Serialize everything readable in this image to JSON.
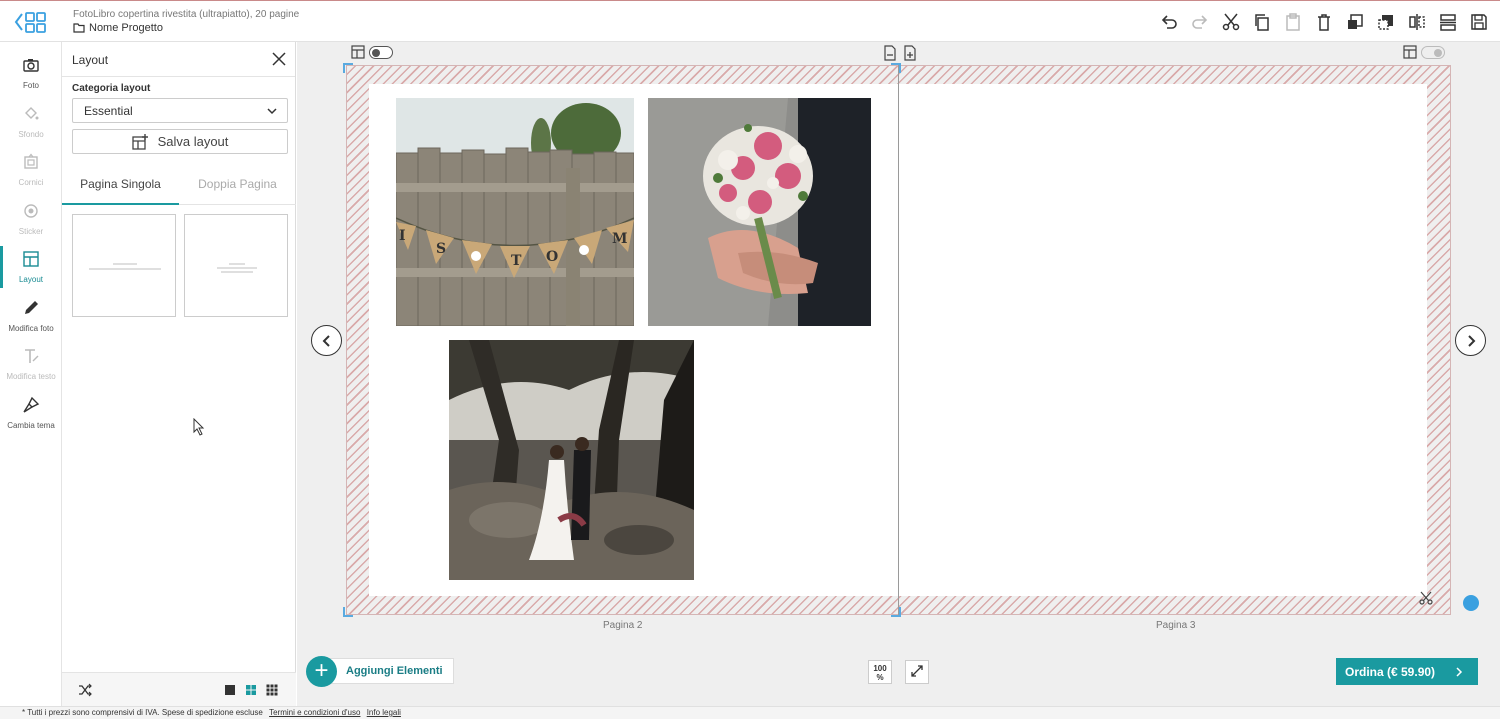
{
  "header": {
    "product": "FotoLibro copertina rivestita (ultrapiatto), 20 pagine",
    "project_name": "Nome Progetto",
    "toolbar": [
      "undo-icon",
      "redo-icon",
      "cut-icon",
      "copy-icon",
      "paste-icon",
      "delete-icon",
      "bring-forward-icon",
      "send-backward-icon",
      "mirror-icon",
      "align-icon",
      "save-icon"
    ]
  },
  "rail": {
    "items": [
      {
        "label": "Foto",
        "icon": "camera-icon",
        "disabled": false
      },
      {
        "label": "Sfondo",
        "icon": "paint-bucket-icon",
        "disabled": true
      },
      {
        "label": "Cornici",
        "icon": "frame-icon",
        "disabled": true
      },
      {
        "label": "Sticker",
        "icon": "sticker-icon",
        "disabled": true
      },
      {
        "label": "Layout",
        "icon": "layout-icon",
        "disabled": false,
        "active": true
      },
      {
        "label": "Modifica foto",
        "icon": "pencil-icon",
        "disabled": false
      },
      {
        "label": "Modifica testo",
        "icon": "text-icon",
        "disabled": true
      },
      {
        "label": "Cambia tema",
        "icon": "brush-icon",
        "disabled": false
      }
    ]
  },
  "panel": {
    "title": "Layout",
    "category_label": "Categoria layout",
    "category_value": "Essential",
    "save_label": "Salva layout",
    "tabs": [
      {
        "label": "Pagina Singola",
        "active": true
      },
      {
        "label": "Doppia Pagina",
        "active": false
      }
    ]
  },
  "canvas": {
    "left_page_label": "Pagina 2",
    "right_page_label": "Pagina 3",
    "add_elements_label": "Aggiungi Elementi",
    "zoom_label": "100 %",
    "order_label": "Ordina (€ 59.90)",
    "accent_color": "#1a9aa0"
  },
  "footer": {
    "text": "* Tutti i prezzi sono comprensivi di IVA. Spese di spedizione escluse",
    "link1": "Termini e condizioni d'uso",
    "link2": "Info legali"
  }
}
